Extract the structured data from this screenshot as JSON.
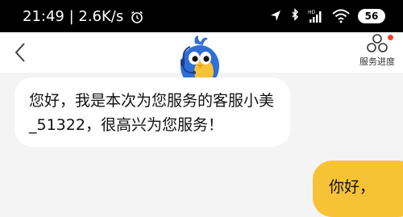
{
  "status_bar": {
    "time_speed": "21:49 | 2.6K/s",
    "battery_level": "56",
    "icons": [
      "alarm-clock-icon",
      "location-arrow-icon",
      "bluetooth-icon",
      "hd-signal-icon",
      "wifi-icon",
      "battery-icon"
    ]
  },
  "header": {
    "back_icon": "chevron-left-icon",
    "avatar_icon": "bird-mascot-icon",
    "progress_icon": "service-progress-icon",
    "progress_label": "服务进度"
  },
  "chat": {
    "agent_message_line1": "您好，我是本次为您服务的客服小美",
    "agent_message_line2": "_51322，很高兴为您服务！",
    "user_message": "你好，"
  },
  "colors": {
    "status_bar": "#000000",
    "header": "#ffffff",
    "chat_background": "#f4f4f4",
    "user_bubble": "#f7c236",
    "mascot_blue": "#2f6fd6",
    "notification_dot": "#ff3b30"
  }
}
